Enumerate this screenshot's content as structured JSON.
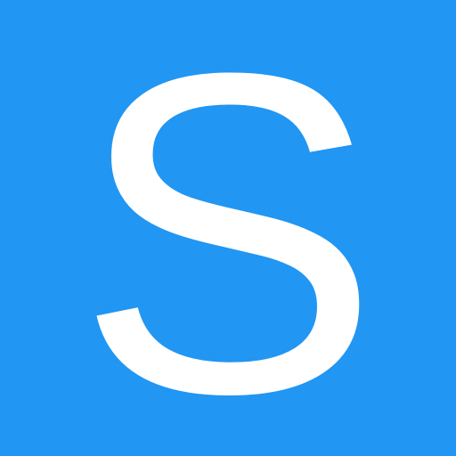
{
  "tile": {
    "letter": "S",
    "background_color": "#2196F3",
    "letter_color": "#FFFFFF"
  }
}
